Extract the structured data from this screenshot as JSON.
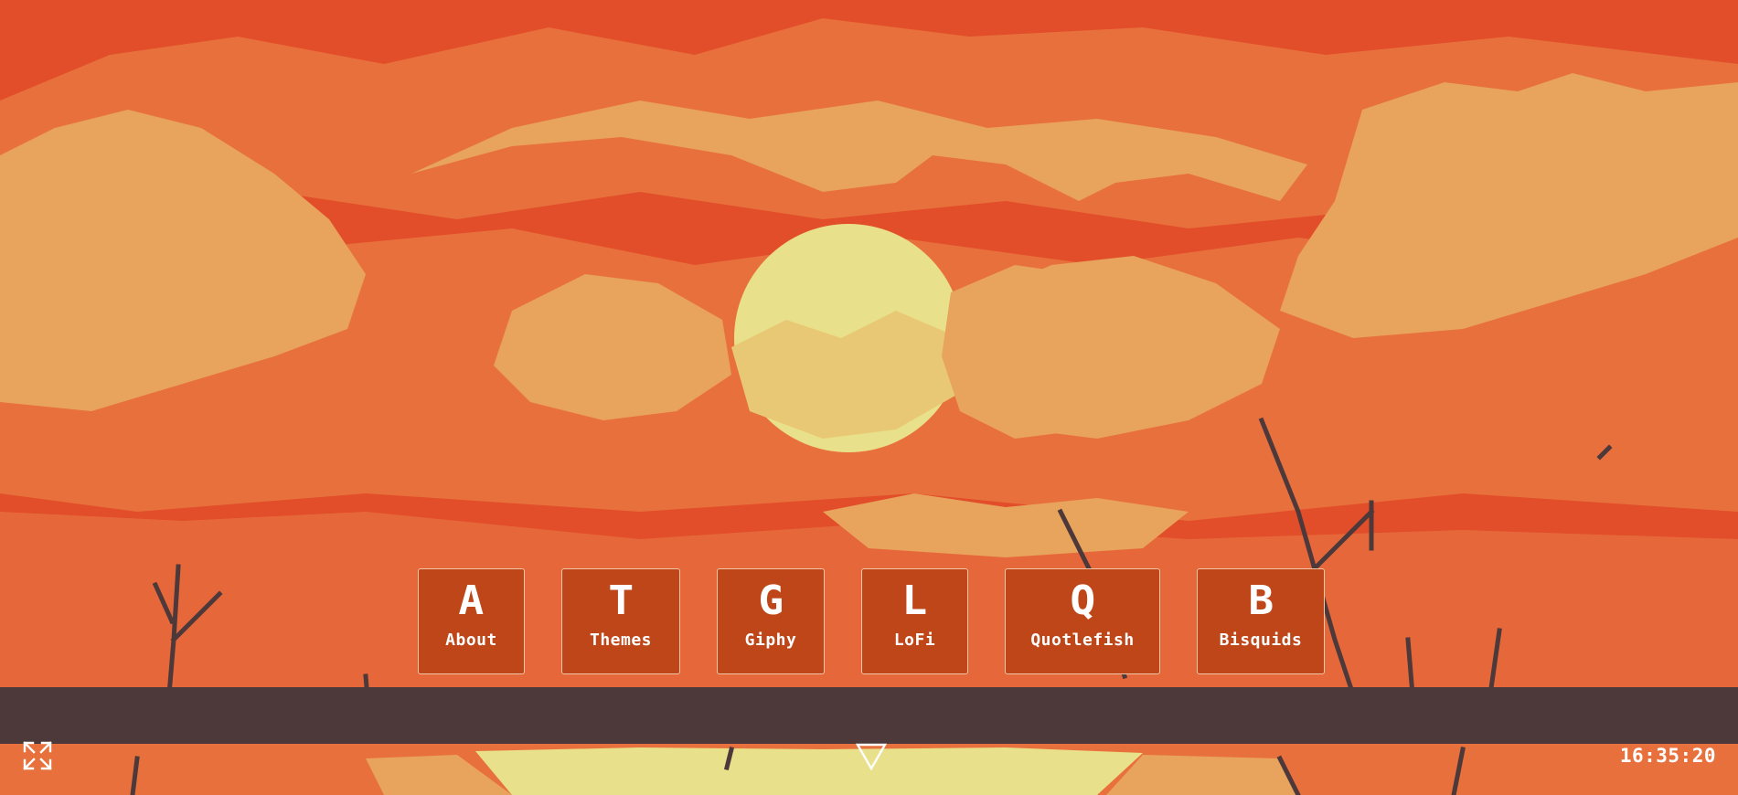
{
  "colors": {
    "sky_base": "#e24d2a",
    "cloud_mid": "#e8703c",
    "cloud_light": "#e8a35c",
    "sun": "#e8e08a",
    "ground_dark": "#4d383a",
    "tile_bg": "#bf4618",
    "tile_border": "#f0c7a6",
    "text": "#ffffff"
  },
  "apps": [
    {
      "letter": "A",
      "label": "About"
    },
    {
      "letter": "T",
      "label": "Themes"
    },
    {
      "letter": "G",
      "label": "Giphy"
    },
    {
      "letter": "L",
      "label": "LoFi"
    },
    {
      "letter": "Q",
      "label": "Quotlefish"
    },
    {
      "letter": "B",
      "label": "Bisquids"
    }
  ],
  "controls": {
    "fullscreen_icon": "expand-icon",
    "scroll_icon": "chevron-down-icon"
  },
  "clock": {
    "time": "16:35:20"
  }
}
